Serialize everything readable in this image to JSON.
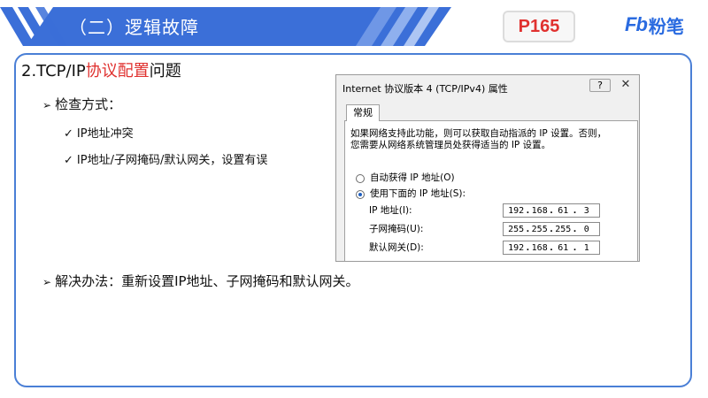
{
  "header": {
    "banner_text": "（二）逻辑故障",
    "page_tag": "P165",
    "logo": {
      "mark": "Fb",
      "text": "粉笔"
    },
    "colors": {
      "banner": "#3b6fd8",
      "page_tag": "#e0312f",
      "logo": "#2a6be0"
    }
  },
  "content": {
    "title": {
      "prefix": "2.TCP/IP",
      "highlight": "协议配置",
      "suffix": "问题"
    },
    "check_method": {
      "label": "检查方式：",
      "items": [
        "IP地址冲突",
        "IP地址/子网掩码/默认网关，设置有误"
      ]
    },
    "solution": "解决办法：重新设置IP地址、子网掩码和默认网关。"
  },
  "dialog": {
    "title": "Internet 协议版本 4 (TCP/IPv4) 属性",
    "help": "?",
    "close": "✕",
    "tab": "常规",
    "desc_line1": "如果网络支持此功能，则可以获取自动指派的 IP 设置。否则，",
    "desc_line2": "您需要从网络系统管理员处获得适当的 IP 设置。",
    "radio_auto": "自动获得 IP 地址(O)",
    "radio_manual": "使用下面的 IP 地址(S):",
    "selected": "manual",
    "fields": [
      {
        "label": "IP 地址(I):",
        "value": [
          "192",
          "168",
          "61",
          "3"
        ]
      },
      {
        "label": "子网掩码(U):",
        "value": [
          "255",
          "255",
          "255",
          "0"
        ]
      },
      {
        "label": "默认网关(D):",
        "value": [
          "192",
          "168",
          "61",
          "1"
        ]
      }
    ]
  }
}
